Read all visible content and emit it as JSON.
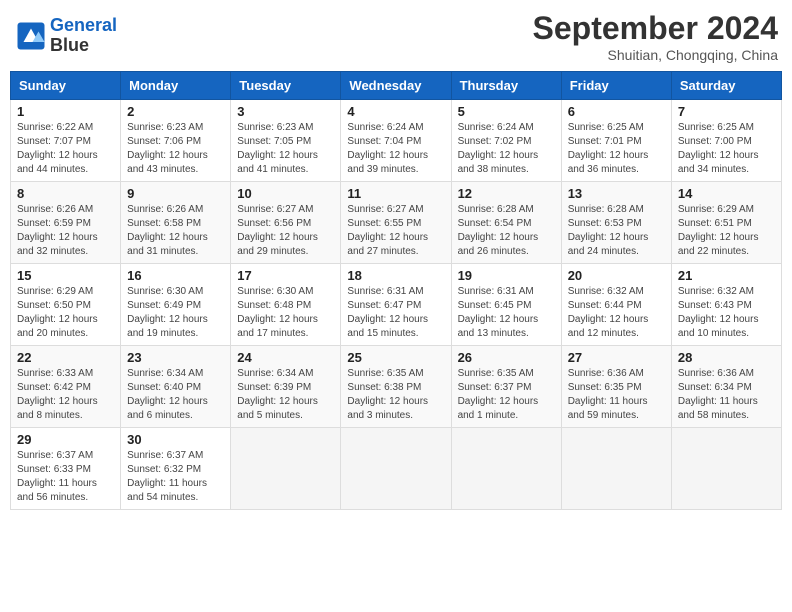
{
  "header": {
    "logo_line1": "General",
    "logo_line2": "Blue",
    "month": "September 2024",
    "location": "Shuitian, Chongqing, China"
  },
  "weekdays": [
    "Sunday",
    "Monday",
    "Tuesday",
    "Wednesday",
    "Thursday",
    "Friday",
    "Saturday"
  ],
  "weeks": [
    [
      {
        "day": "1",
        "sunrise": "6:22 AM",
        "sunset": "7:07 PM",
        "daylight": "12 hours and 44 minutes."
      },
      {
        "day": "2",
        "sunrise": "6:23 AM",
        "sunset": "7:06 PM",
        "daylight": "12 hours and 43 minutes."
      },
      {
        "day": "3",
        "sunrise": "6:23 AM",
        "sunset": "7:05 PM",
        "daylight": "12 hours and 41 minutes."
      },
      {
        "day": "4",
        "sunrise": "6:24 AM",
        "sunset": "7:04 PM",
        "daylight": "12 hours and 39 minutes."
      },
      {
        "day": "5",
        "sunrise": "6:24 AM",
        "sunset": "7:02 PM",
        "daylight": "12 hours and 38 minutes."
      },
      {
        "day": "6",
        "sunrise": "6:25 AM",
        "sunset": "7:01 PM",
        "daylight": "12 hours and 36 minutes."
      },
      {
        "day": "7",
        "sunrise": "6:25 AM",
        "sunset": "7:00 PM",
        "daylight": "12 hours and 34 minutes."
      }
    ],
    [
      {
        "day": "8",
        "sunrise": "6:26 AM",
        "sunset": "6:59 PM",
        "daylight": "12 hours and 32 minutes."
      },
      {
        "day": "9",
        "sunrise": "6:26 AM",
        "sunset": "6:58 PM",
        "daylight": "12 hours and 31 minutes."
      },
      {
        "day": "10",
        "sunrise": "6:27 AM",
        "sunset": "6:56 PM",
        "daylight": "12 hours and 29 minutes."
      },
      {
        "day": "11",
        "sunrise": "6:27 AM",
        "sunset": "6:55 PM",
        "daylight": "12 hours and 27 minutes."
      },
      {
        "day": "12",
        "sunrise": "6:28 AM",
        "sunset": "6:54 PM",
        "daylight": "12 hours and 26 minutes."
      },
      {
        "day": "13",
        "sunrise": "6:28 AM",
        "sunset": "6:53 PM",
        "daylight": "12 hours and 24 minutes."
      },
      {
        "day": "14",
        "sunrise": "6:29 AM",
        "sunset": "6:51 PM",
        "daylight": "12 hours and 22 minutes."
      }
    ],
    [
      {
        "day": "15",
        "sunrise": "6:29 AM",
        "sunset": "6:50 PM",
        "daylight": "12 hours and 20 minutes."
      },
      {
        "day": "16",
        "sunrise": "6:30 AM",
        "sunset": "6:49 PM",
        "daylight": "12 hours and 19 minutes."
      },
      {
        "day": "17",
        "sunrise": "6:30 AM",
        "sunset": "6:48 PM",
        "daylight": "12 hours and 17 minutes."
      },
      {
        "day": "18",
        "sunrise": "6:31 AM",
        "sunset": "6:47 PM",
        "daylight": "12 hours and 15 minutes."
      },
      {
        "day": "19",
        "sunrise": "6:31 AM",
        "sunset": "6:45 PM",
        "daylight": "12 hours and 13 minutes."
      },
      {
        "day": "20",
        "sunrise": "6:32 AM",
        "sunset": "6:44 PM",
        "daylight": "12 hours and 12 minutes."
      },
      {
        "day": "21",
        "sunrise": "6:32 AM",
        "sunset": "6:43 PM",
        "daylight": "12 hours and 10 minutes."
      }
    ],
    [
      {
        "day": "22",
        "sunrise": "6:33 AM",
        "sunset": "6:42 PM",
        "daylight": "12 hours and 8 minutes."
      },
      {
        "day": "23",
        "sunrise": "6:34 AM",
        "sunset": "6:40 PM",
        "daylight": "12 hours and 6 minutes."
      },
      {
        "day": "24",
        "sunrise": "6:34 AM",
        "sunset": "6:39 PM",
        "daylight": "12 hours and 5 minutes."
      },
      {
        "day": "25",
        "sunrise": "6:35 AM",
        "sunset": "6:38 PM",
        "daylight": "12 hours and 3 minutes."
      },
      {
        "day": "26",
        "sunrise": "6:35 AM",
        "sunset": "6:37 PM",
        "daylight": "12 hours and 1 minute."
      },
      {
        "day": "27",
        "sunrise": "6:36 AM",
        "sunset": "6:35 PM",
        "daylight": "11 hours and 59 minutes."
      },
      {
        "day": "28",
        "sunrise": "6:36 AM",
        "sunset": "6:34 PM",
        "daylight": "11 hours and 58 minutes."
      }
    ],
    [
      {
        "day": "29",
        "sunrise": "6:37 AM",
        "sunset": "6:33 PM",
        "daylight": "11 hours and 56 minutes."
      },
      {
        "day": "30",
        "sunrise": "6:37 AM",
        "sunset": "6:32 PM",
        "daylight": "11 hours and 54 minutes."
      },
      null,
      null,
      null,
      null,
      null
    ]
  ]
}
